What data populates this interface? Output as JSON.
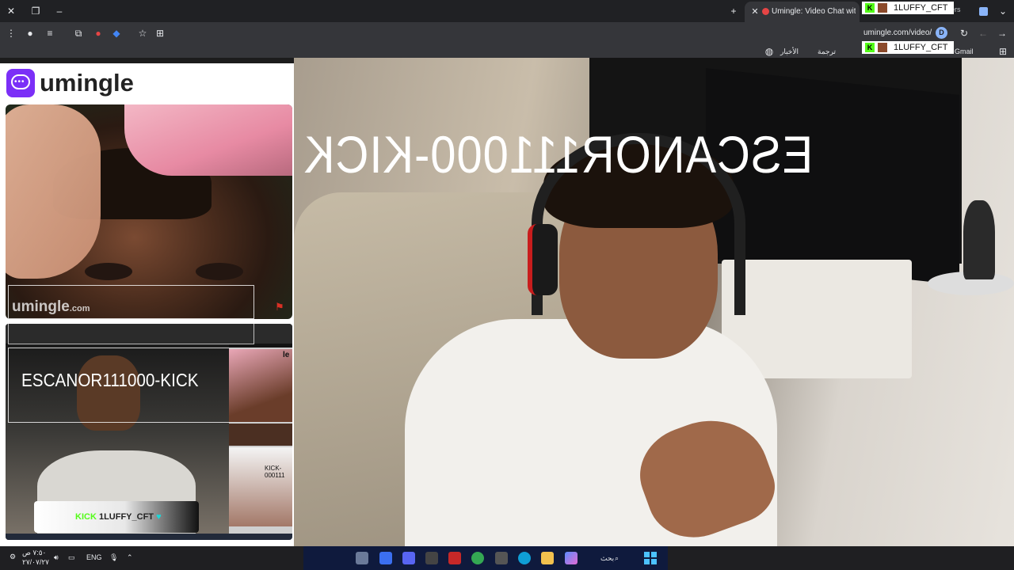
{
  "browser": {
    "active_tab_title": "Umingle: Video Chat with S",
    "other_tab_fragment": "ngers",
    "url": "umingle.com/video/",
    "profile_initial": "D",
    "bookmarks": [
      "Gmail",
      "ترجمة",
      "الأخبار"
    ]
  },
  "overlay_badge": {
    "kick_letter": "K",
    "username": "1LUFFY_CFT"
  },
  "umingle": {
    "logo_text": "umingle",
    "watermark": "umingle",
    "watermark_suffix": ".com"
  },
  "self_view": {
    "tag_text": "ESCANOR111000-KICK",
    "name_card": {
      "kick_word": "KICK",
      "username": "1LUFFY_CFT",
      "heart": "♥"
    },
    "thumb_label_top": "le",
    "thumb_label_mid": "KICK-000111"
  },
  "main_video": {
    "overlay_text": "ESCANOR111000-KICK"
  },
  "taskbar": {
    "time": "٧:٥٠ ص",
    "date": "٢٧/٠٧/٢٧",
    "language": "ENG",
    "search_label": "بحث"
  },
  "colors": {
    "umingle_purple": "#7b2ff7",
    "kick_green": "#53fc18"
  }
}
